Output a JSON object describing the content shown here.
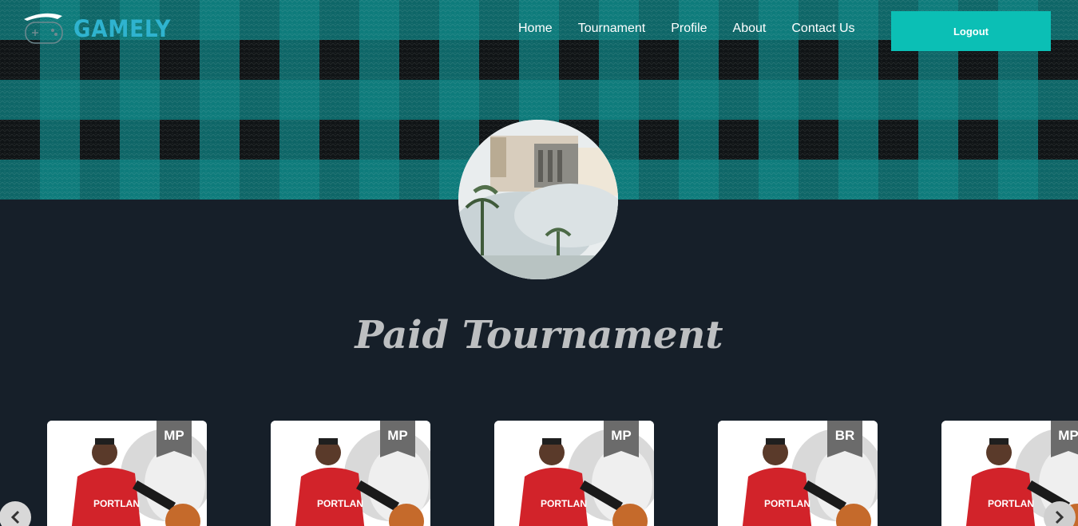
{
  "header": {
    "logo_text": "GAMELY",
    "nav": [
      "Home",
      "Tournament",
      "Profile",
      "About",
      "Contact Us"
    ],
    "logout_label": "Logout"
  },
  "colors": {
    "accent": "#0bbfb5",
    "page_background": "#161f29",
    "logo": "#2fb3cf"
  },
  "main": {
    "section_title": "Paid Tournament",
    "cards": [
      {
        "badge": "MP"
      },
      {
        "badge": "MP"
      },
      {
        "badge": "MP"
      },
      {
        "badge": "BR"
      },
      {
        "badge": "MP"
      }
    ]
  },
  "icons": {
    "carousel_prev": "chevron-left-icon",
    "carousel_next": "chevron-right-icon",
    "logo": "gamepad-icon"
  }
}
